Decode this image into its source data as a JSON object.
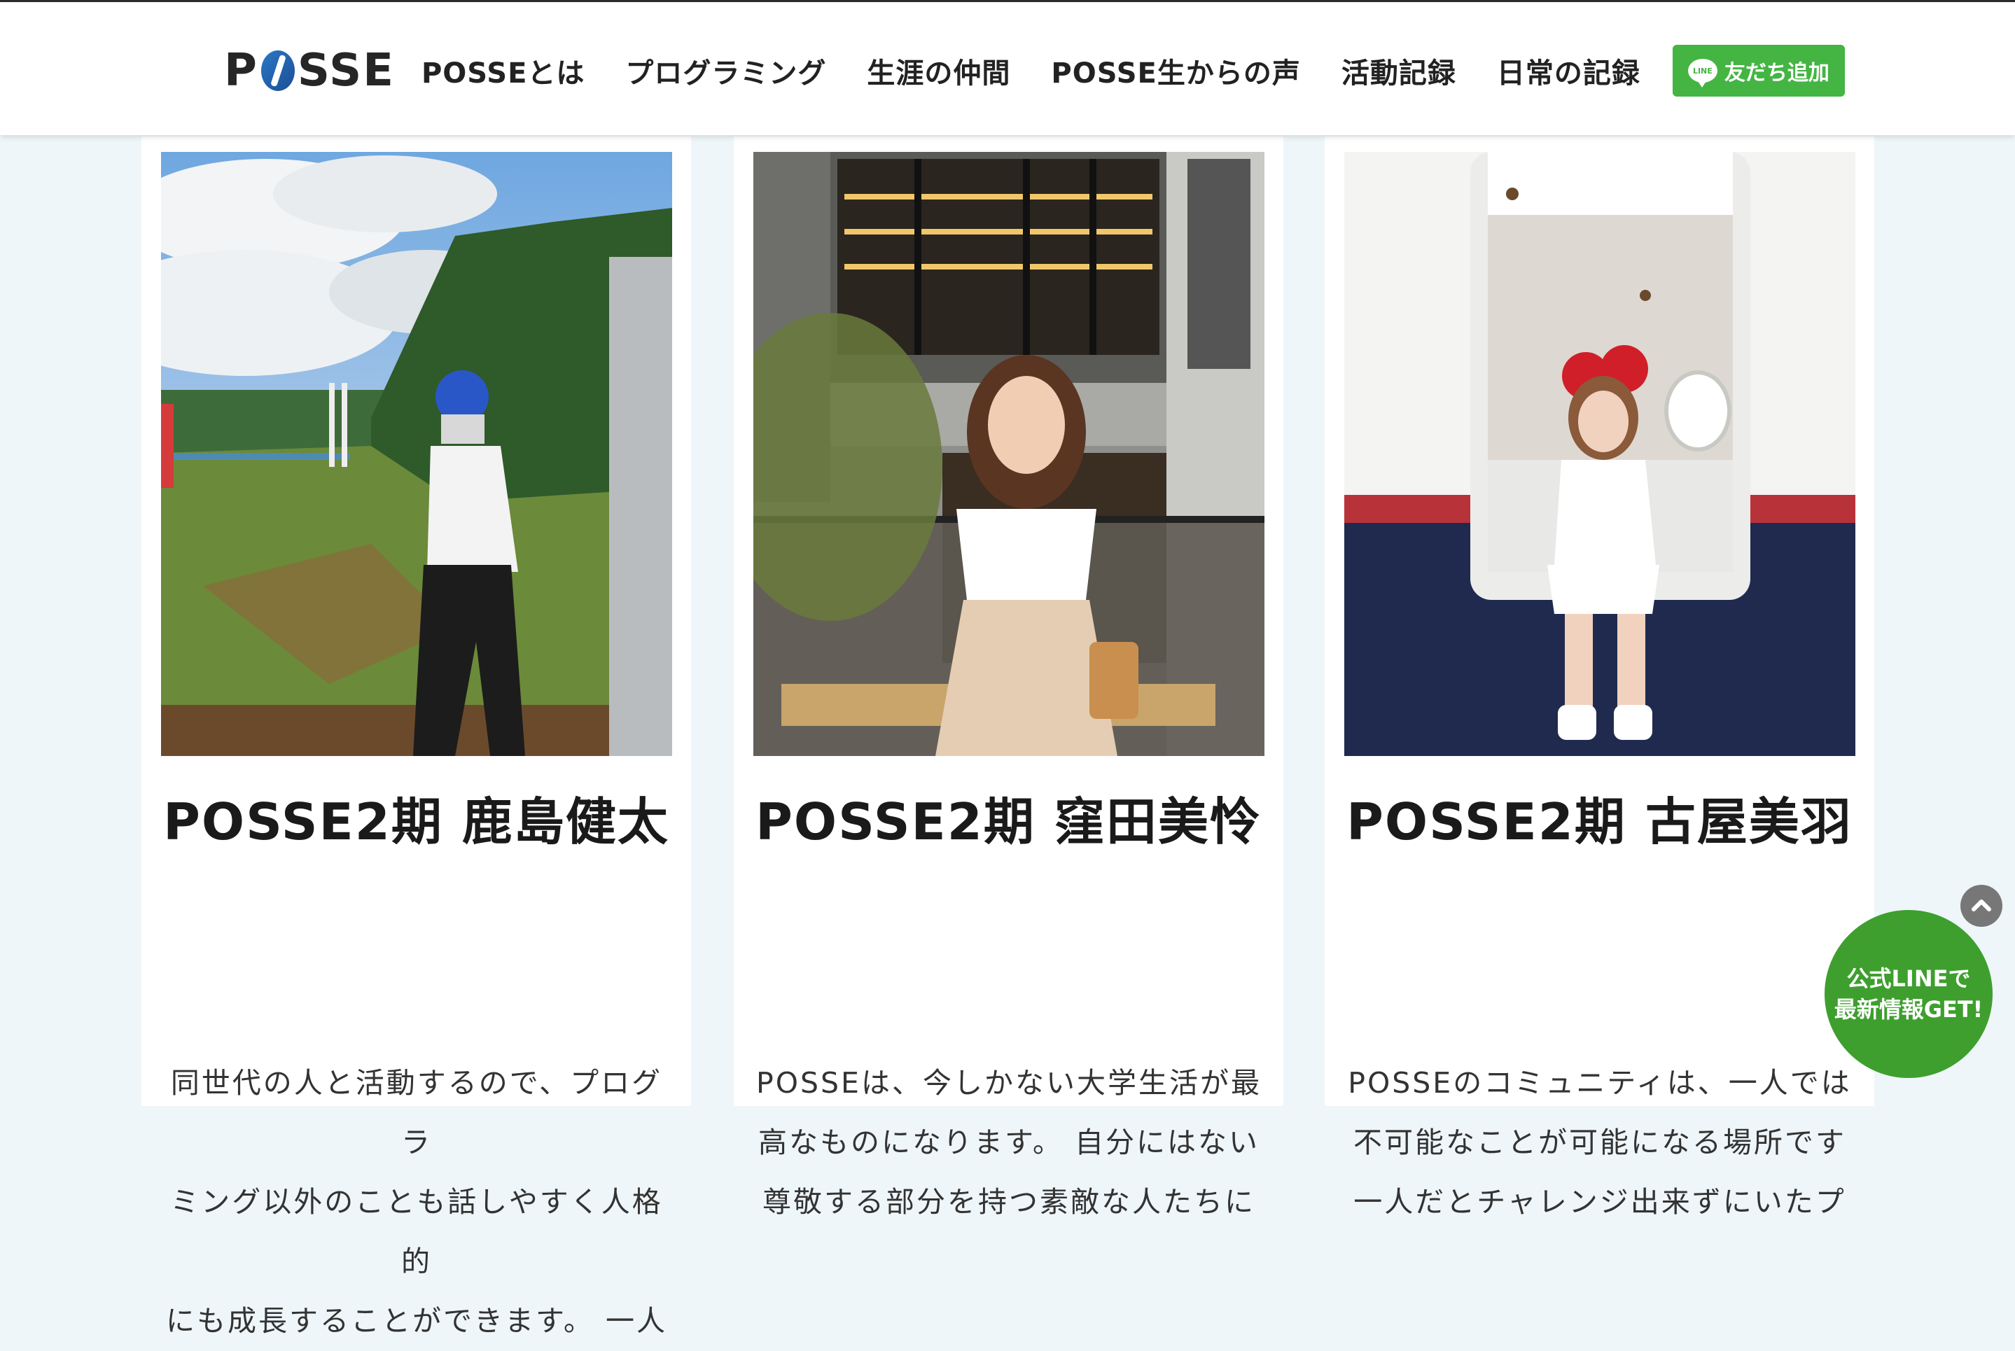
{
  "header": {
    "logo": "POSSE",
    "nav": [
      "POSSEとは",
      "プログラミング",
      "生涯の仲間",
      "POSSE生からの声",
      "活動記録",
      "日常の記録"
    ],
    "line_button": "友だち追加",
    "line_icon_text": "LINE"
  },
  "cards": [
    {
      "name": "POSSE2期 鹿島健太",
      "desc_lines": [
        "同世代の人と活動するので、プログラ",
        "ミング以外のことも話しやすく人格的",
        "にも成長することができます。 一人"
      ]
    },
    {
      "name": "POSSE2期 窪田美怜",
      "desc_lines": [
        "POSSEは、今しかない大学生活が最",
        "高なものになります。 自分にはない",
        "尊敬する部分を持つ素敵な人たちに"
      ]
    },
    {
      "name": "POSSE2期 古屋美羽",
      "desc_lines": [
        "POSSEのコミュニティは、一人では",
        "不可能なことが可能になる場所です",
        "一人だとチャレンジ出来ずにいたプ"
      ]
    }
  ],
  "floating": {
    "line_cta_line1": "公式LINEで",
    "line_cta_line2": "最新情報GET!"
  },
  "colors": {
    "line_green": "#44b543",
    "line_cta_green": "#3e9f2e",
    "page_bg": "#eef6f9",
    "logo_blue": "#2b77c6"
  }
}
